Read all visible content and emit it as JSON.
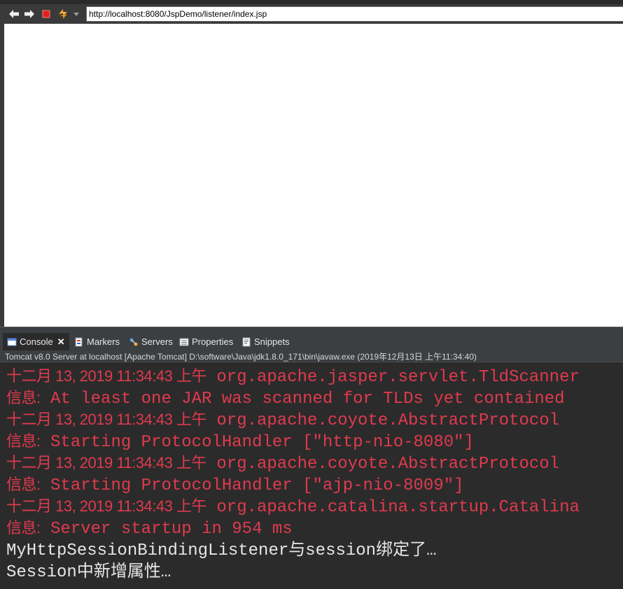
{
  "browser": {
    "url": "http://localhost:8080/JspDemo/listener/index.jsp",
    "buttons": [
      "back",
      "forward",
      "stop",
      "refresh",
      "menu"
    ]
  },
  "views": {
    "tabs": [
      {
        "label": "Console",
        "icon": "console-icon",
        "active": true
      },
      {
        "label": "Markers",
        "icon": "markers-icon",
        "active": false
      },
      {
        "label": "Servers",
        "icon": "servers-icon",
        "active": false
      },
      {
        "label": "Properties",
        "icon": "properties-icon",
        "active": false
      },
      {
        "label": "Snippets",
        "icon": "snippets-icon",
        "active": false
      }
    ]
  },
  "console": {
    "process": "Tomcat v8.0 Server at localhost [Apache Tomcat] D:\\software\\Java\\jdk1.8.0_171\\bin\\javaw.exe (2019年12月13日 上午11:34:40)",
    "lines": [
      {
        "date": "十二月 13, 2019 11:34:43 上午",
        "text": " org.apache.jasper.servlet.TldScanner"
      },
      {
        "date": "信息:",
        "text": " At least one JAR was scanned for TLDs yet contained"
      },
      {
        "date": "十二月 13, 2019 11:34:43 上午",
        "text": " org.apache.coyote.AbstractProtocol"
      },
      {
        "date": "信息:",
        "text": " Starting ProtocolHandler [\"http-nio-8080\"]"
      },
      {
        "date": "十二月 13, 2019 11:34:43 上午",
        "text": " org.apache.coyote.AbstractProtocol"
      },
      {
        "date": "信息:",
        "text": " Starting ProtocolHandler [\"ajp-nio-8009\"]"
      },
      {
        "date": "十二月 13, 2019 11:34:43 上午",
        "text": " org.apache.catalina.startup.Catalina"
      },
      {
        "date": "信息:",
        "text": " Server startup in 954 ms"
      }
    ],
    "stdout": [
      "MyHttpSessionBindingListener与session绑定了…",
      "Session中新增属性…"
    ]
  },
  "colors": {
    "stderr": "#e03a4e",
    "stdout": "#e6e6e6",
    "background": "#2b2b2b"
  }
}
